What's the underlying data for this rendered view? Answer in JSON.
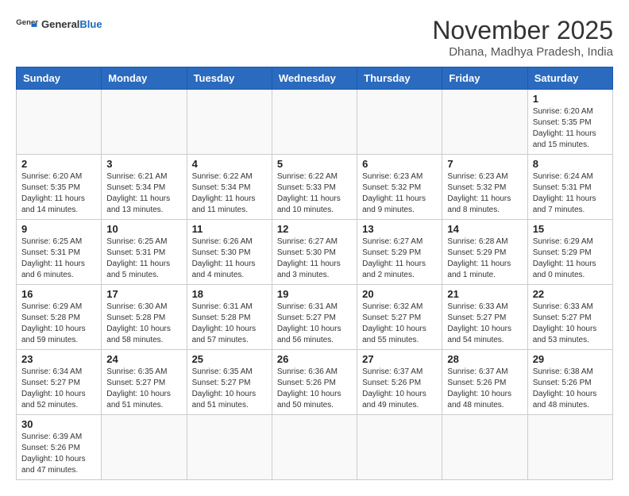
{
  "logo": {
    "text_general": "General",
    "text_blue": "Blue"
  },
  "title": "November 2025",
  "subtitle": "Dhana, Madhya Pradesh, India",
  "weekdays": [
    "Sunday",
    "Monday",
    "Tuesday",
    "Wednesday",
    "Thursday",
    "Friday",
    "Saturday"
  ],
  "weeks": [
    [
      {
        "day": "",
        "info": ""
      },
      {
        "day": "",
        "info": ""
      },
      {
        "day": "",
        "info": ""
      },
      {
        "day": "",
        "info": ""
      },
      {
        "day": "",
        "info": ""
      },
      {
        "day": "",
        "info": ""
      },
      {
        "day": "1",
        "info": "Sunrise: 6:20 AM\nSunset: 5:35 PM\nDaylight: 11 hours\nand 15 minutes."
      }
    ],
    [
      {
        "day": "2",
        "info": "Sunrise: 6:20 AM\nSunset: 5:35 PM\nDaylight: 11 hours\nand 14 minutes."
      },
      {
        "day": "3",
        "info": "Sunrise: 6:21 AM\nSunset: 5:34 PM\nDaylight: 11 hours\nand 13 minutes."
      },
      {
        "day": "4",
        "info": "Sunrise: 6:22 AM\nSunset: 5:34 PM\nDaylight: 11 hours\nand 11 minutes."
      },
      {
        "day": "5",
        "info": "Sunrise: 6:22 AM\nSunset: 5:33 PM\nDaylight: 11 hours\nand 10 minutes."
      },
      {
        "day": "6",
        "info": "Sunrise: 6:23 AM\nSunset: 5:32 PM\nDaylight: 11 hours\nand 9 minutes."
      },
      {
        "day": "7",
        "info": "Sunrise: 6:23 AM\nSunset: 5:32 PM\nDaylight: 11 hours\nand 8 minutes."
      },
      {
        "day": "8",
        "info": "Sunrise: 6:24 AM\nSunset: 5:31 PM\nDaylight: 11 hours\nand 7 minutes."
      }
    ],
    [
      {
        "day": "9",
        "info": "Sunrise: 6:25 AM\nSunset: 5:31 PM\nDaylight: 11 hours\nand 6 minutes."
      },
      {
        "day": "10",
        "info": "Sunrise: 6:25 AM\nSunset: 5:31 PM\nDaylight: 11 hours\nand 5 minutes."
      },
      {
        "day": "11",
        "info": "Sunrise: 6:26 AM\nSunset: 5:30 PM\nDaylight: 11 hours\nand 4 minutes."
      },
      {
        "day": "12",
        "info": "Sunrise: 6:27 AM\nSunset: 5:30 PM\nDaylight: 11 hours\nand 3 minutes."
      },
      {
        "day": "13",
        "info": "Sunrise: 6:27 AM\nSunset: 5:29 PM\nDaylight: 11 hours\nand 2 minutes."
      },
      {
        "day": "14",
        "info": "Sunrise: 6:28 AM\nSunset: 5:29 PM\nDaylight: 11 hours\nand 1 minute."
      },
      {
        "day": "15",
        "info": "Sunrise: 6:29 AM\nSunset: 5:29 PM\nDaylight: 11 hours\nand 0 minutes."
      }
    ],
    [
      {
        "day": "16",
        "info": "Sunrise: 6:29 AM\nSunset: 5:28 PM\nDaylight: 10 hours\nand 59 minutes."
      },
      {
        "day": "17",
        "info": "Sunrise: 6:30 AM\nSunset: 5:28 PM\nDaylight: 10 hours\nand 58 minutes."
      },
      {
        "day": "18",
        "info": "Sunrise: 6:31 AM\nSunset: 5:28 PM\nDaylight: 10 hours\nand 57 minutes."
      },
      {
        "day": "19",
        "info": "Sunrise: 6:31 AM\nSunset: 5:27 PM\nDaylight: 10 hours\nand 56 minutes."
      },
      {
        "day": "20",
        "info": "Sunrise: 6:32 AM\nSunset: 5:27 PM\nDaylight: 10 hours\nand 55 minutes."
      },
      {
        "day": "21",
        "info": "Sunrise: 6:33 AM\nSunset: 5:27 PM\nDaylight: 10 hours\nand 54 minutes."
      },
      {
        "day": "22",
        "info": "Sunrise: 6:33 AM\nSunset: 5:27 PM\nDaylight: 10 hours\nand 53 minutes."
      }
    ],
    [
      {
        "day": "23",
        "info": "Sunrise: 6:34 AM\nSunset: 5:27 PM\nDaylight: 10 hours\nand 52 minutes."
      },
      {
        "day": "24",
        "info": "Sunrise: 6:35 AM\nSunset: 5:27 PM\nDaylight: 10 hours\nand 51 minutes."
      },
      {
        "day": "25",
        "info": "Sunrise: 6:35 AM\nSunset: 5:27 PM\nDaylight: 10 hours\nand 51 minutes."
      },
      {
        "day": "26",
        "info": "Sunrise: 6:36 AM\nSunset: 5:26 PM\nDaylight: 10 hours\nand 50 minutes."
      },
      {
        "day": "27",
        "info": "Sunrise: 6:37 AM\nSunset: 5:26 PM\nDaylight: 10 hours\nand 49 minutes."
      },
      {
        "day": "28",
        "info": "Sunrise: 6:37 AM\nSunset: 5:26 PM\nDaylight: 10 hours\nand 48 minutes."
      },
      {
        "day": "29",
        "info": "Sunrise: 6:38 AM\nSunset: 5:26 PM\nDaylight: 10 hours\nand 48 minutes."
      }
    ],
    [
      {
        "day": "30",
        "info": "Sunrise: 6:39 AM\nSunset: 5:26 PM\nDaylight: 10 hours\nand 47 minutes."
      },
      {
        "day": "",
        "info": ""
      },
      {
        "day": "",
        "info": ""
      },
      {
        "day": "",
        "info": ""
      },
      {
        "day": "",
        "info": ""
      },
      {
        "day": "",
        "info": ""
      },
      {
        "day": "",
        "info": ""
      }
    ]
  ]
}
